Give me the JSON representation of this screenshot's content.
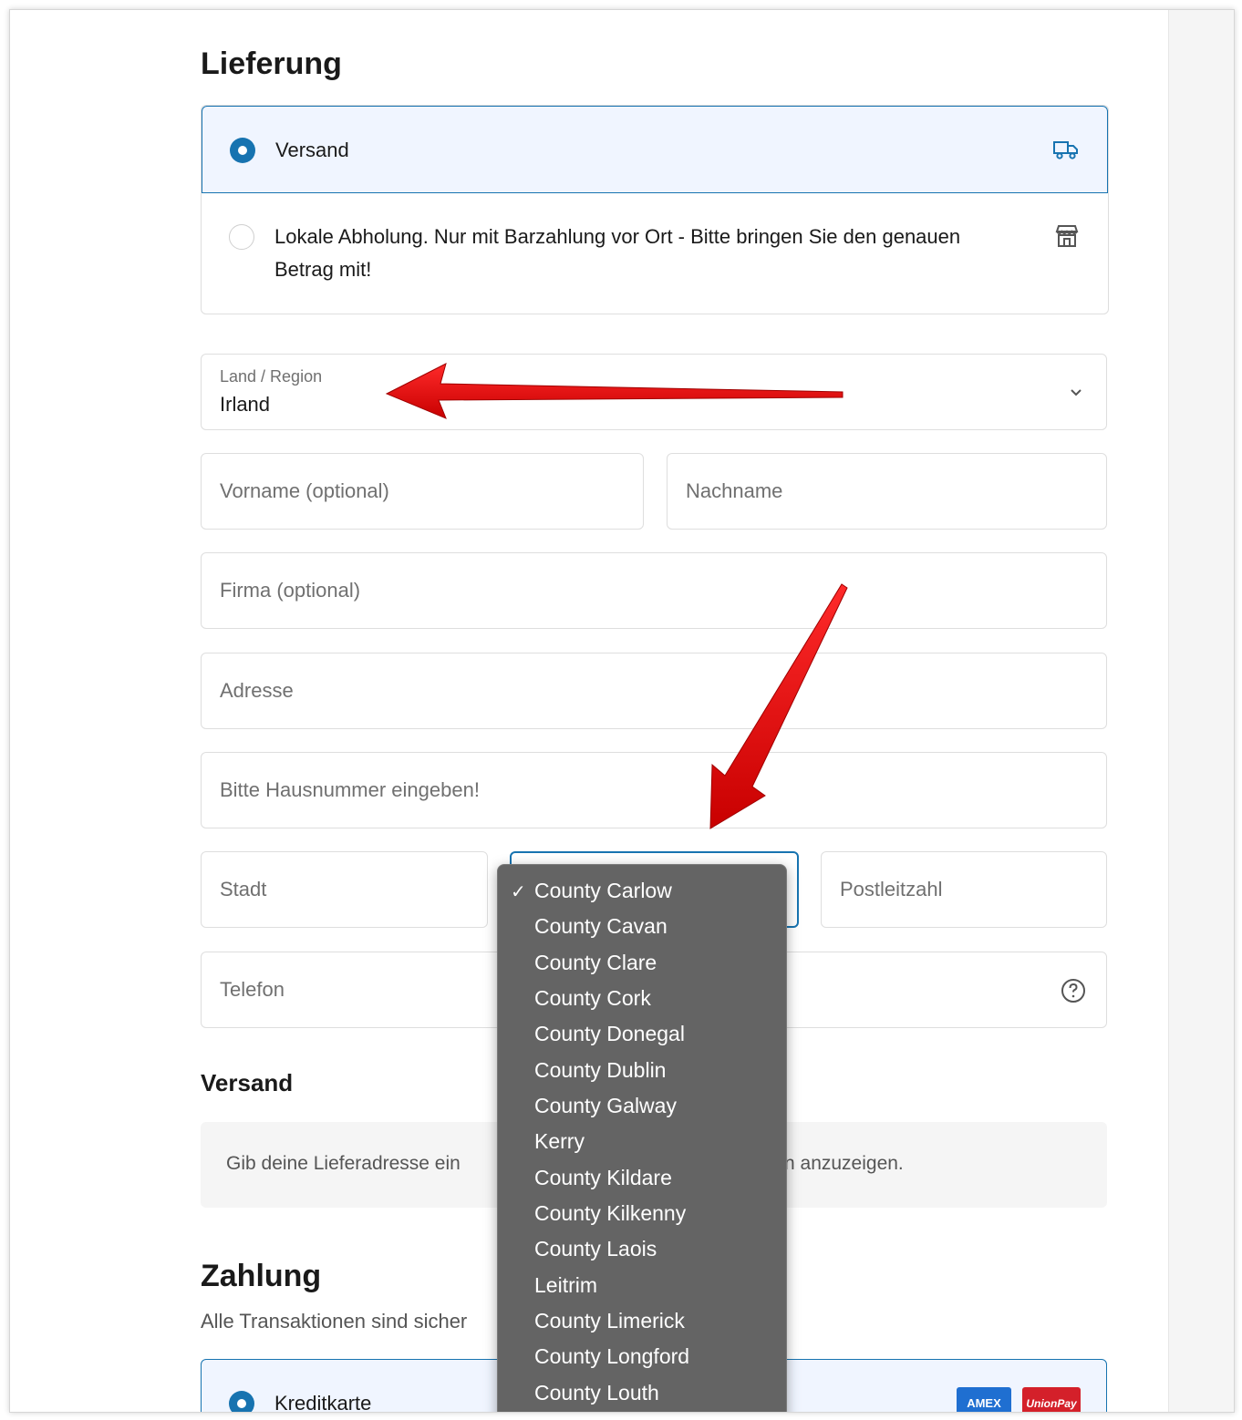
{
  "delivery": {
    "title": "Lieferung",
    "options": [
      {
        "label": "Versand",
        "selected": true,
        "icon": "truck-icon"
      },
      {
        "label": "Lokale Abholung. Nur mit Barzahlung vor Ort - Bitte bringen Sie den genauen Betrag mit!",
        "selected": false,
        "icon": "store-icon"
      }
    ]
  },
  "address_form": {
    "country": {
      "label": "Land / Region",
      "value": "Irland"
    },
    "first_name_placeholder": "Vorname (optional)",
    "last_name_placeholder": "Nachname",
    "company_placeholder": "Firma (optional)",
    "address_placeholder": "Adresse",
    "house_number_placeholder": "Bitte Hausnummer eingeben!",
    "city_placeholder": "Stadt",
    "postal_code_placeholder": "Postleitzahl",
    "phone_placeholder": "Telefon"
  },
  "county_dropdown": {
    "selected": "County Carlow",
    "options": [
      "County Carlow",
      "County Cavan",
      "County Clare",
      "County Cork",
      "County Donegal",
      "County Dublin",
      "County Galway",
      "Kerry",
      "County Kildare",
      "County Kilkenny",
      "County Laois",
      "Leitrim",
      "County Limerick",
      "County Longford",
      "County Louth"
    ]
  },
  "shipping": {
    "title": "Versand",
    "info_left": "Gib deine Lieferadresse ein",
    "info_right": "n anzuzeigen."
  },
  "payment": {
    "title": "Zahlung",
    "subtitle": "Alle Transaktionen sind sicher",
    "option_label": "Kreditkarte",
    "card_logos": [
      "AMEX",
      "UnionPay"
    ]
  },
  "colors": {
    "accent": "#1773b0",
    "annotation_arrow": "#e00000",
    "dropdown_bg": "#646464"
  }
}
